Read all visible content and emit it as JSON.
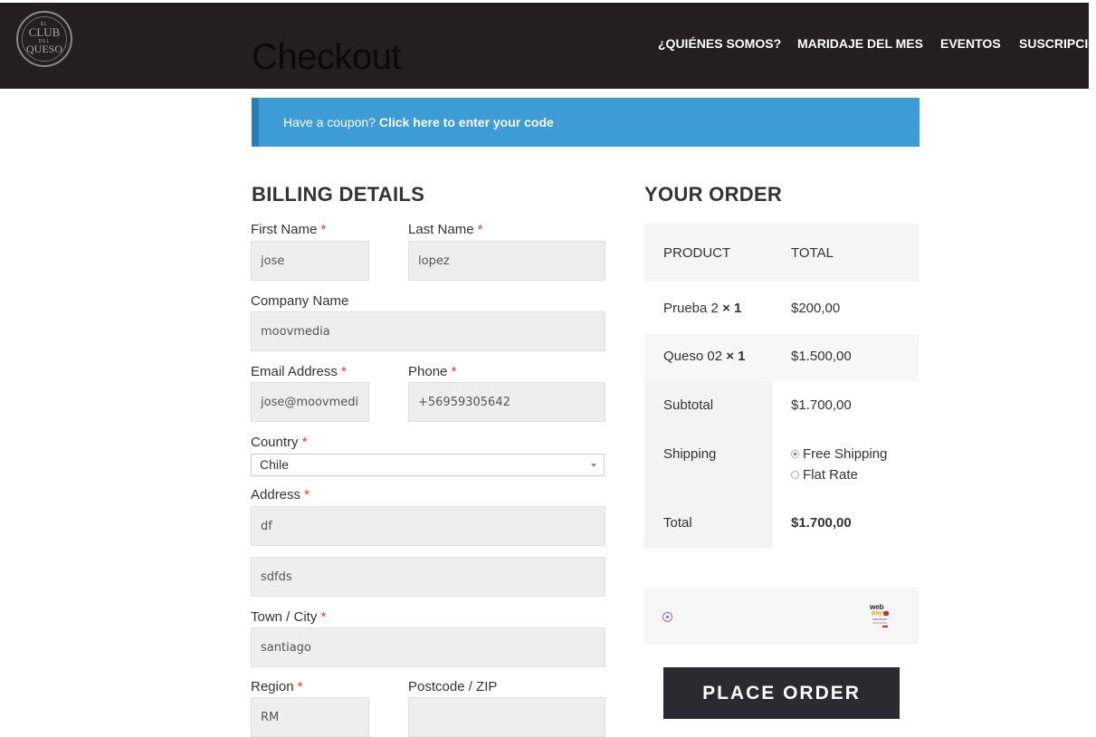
{
  "header": {
    "logo": {
      "line1": "EL",
      "line2": "CLUB",
      "line3": "DEL",
      "line4": "QUESO"
    },
    "page_title": "Checkout",
    "nav": [
      "¿QUIÉNES SOMOS?",
      "MARIDAJE DEL MES",
      "EVENTOS",
      "SUSCRIPCIÓN"
    ]
  },
  "coupon": {
    "text": "Have a coupon? ",
    "link": "Click here to enter your code"
  },
  "billing": {
    "heading": "BILLING DETAILS",
    "required_mark": "*",
    "fields": {
      "first_name": {
        "label": "First Name",
        "value": "jose"
      },
      "last_name": {
        "label": "Last Name",
        "value": "lopez"
      },
      "company": {
        "label": "Company Name",
        "value": "moovmedia"
      },
      "email": {
        "label": "Email Address",
        "value": "jose@moovmedia"
      },
      "phone": {
        "label": "Phone",
        "value": "+56959305642"
      },
      "country": {
        "label": "Country",
        "value": "Chile"
      },
      "address": {
        "label": "Address",
        "value": "df",
        "value2": "sdfds"
      },
      "city": {
        "label": "Town / City",
        "value": "santiago"
      },
      "region": {
        "label": "Region",
        "value": "RM"
      },
      "postcode": {
        "label": "Postcode / ZIP",
        "value": ""
      }
    }
  },
  "order": {
    "heading": "YOUR ORDER",
    "col_product": "PRODUCT",
    "col_total": "TOTAL",
    "items": [
      {
        "name": "Prueba 2",
        "qty": "× 1",
        "total": "$200,00"
      },
      {
        "name": "Queso 02",
        "qty": "× 1",
        "total": "$1.500,00"
      }
    ],
    "subtotal_label": "Subtotal",
    "subtotal": "$1.700,00",
    "shipping_label": "Shipping",
    "shipping_options": [
      {
        "label": "Free Shipping",
        "checked": true
      },
      {
        "label": "Flat Rate",
        "checked": false
      }
    ],
    "total_label": "Total",
    "total": "$1.700,00"
  },
  "payment": {
    "logo_top": "web",
    "logo_bottom": "pay"
  },
  "place_order": "PLACE ORDER",
  "colors": {
    "header": "#231f20",
    "coupon": "#3d9cd6",
    "required": "#e2401c",
    "button": "#2b2a30",
    "payment_radio": "#a46497"
  }
}
